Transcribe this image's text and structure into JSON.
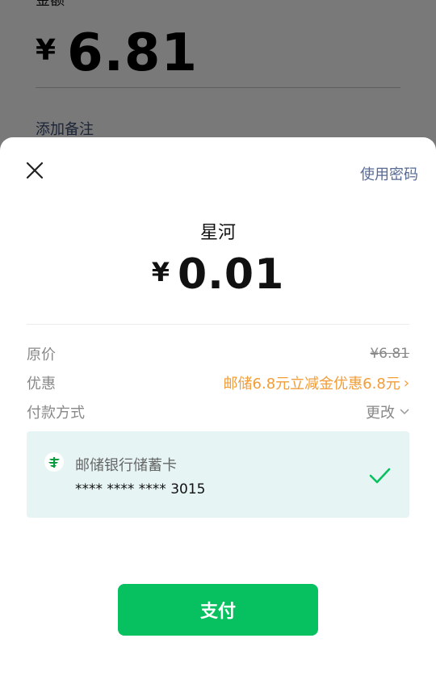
{
  "background": {
    "label": "金额",
    "currency": "¥",
    "amount": "6.81",
    "remark_link": "添加备注"
  },
  "sheet": {
    "use_password": "使用密码",
    "merchant": "星河",
    "currency": "¥",
    "amount": "0.01",
    "original_price_label": "原价",
    "original_price_value": "¥6.81",
    "discount_label": "优惠",
    "discount_value": "邮储6.8元立减金优惠6.8元",
    "payment_method_label": "付款方式",
    "change_label": "更改",
    "card": {
      "bank_name": "邮储银行储蓄卡",
      "card_number": "**** **** **** 3015"
    },
    "pay_button": "支付"
  },
  "colors": {
    "primary_green": "#07c160",
    "link_blue": "#576b95",
    "discount_orange": "#f29d38",
    "card_bg": "#e6f4f4"
  },
  "icons": [
    "close-icon",
    "chevron-right-icon",
    "chevron-down-icon",
    "bank-logo-icon",
    "checkmark-icon"
  ]
}
